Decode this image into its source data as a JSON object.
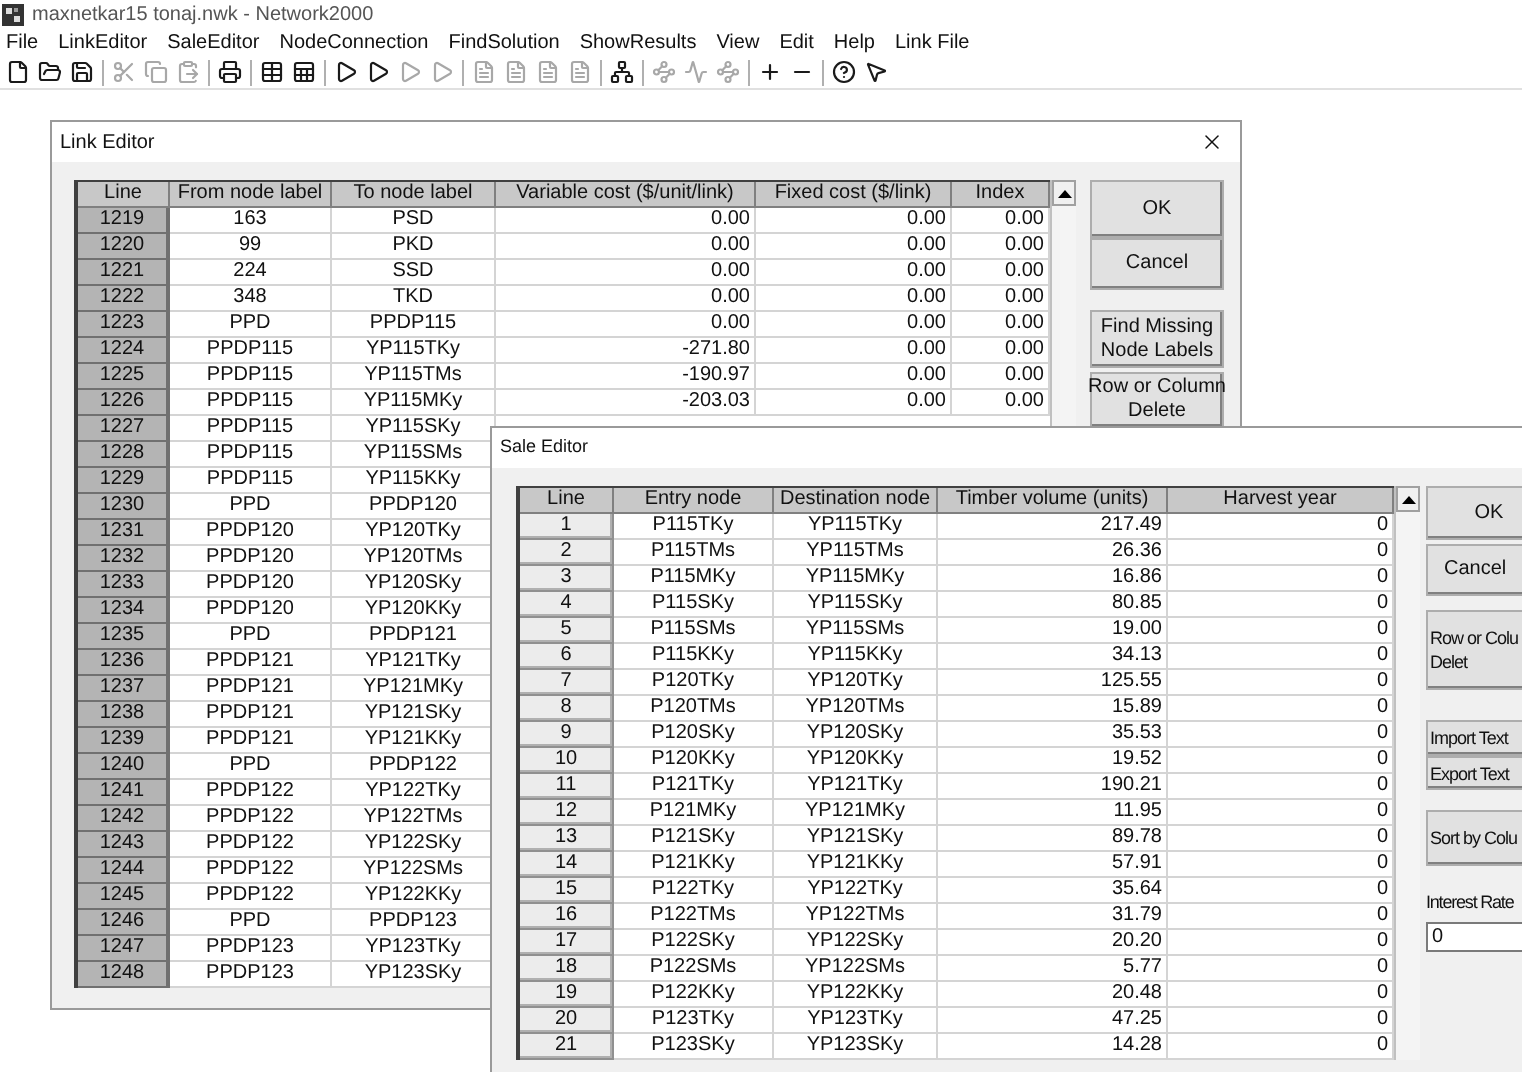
{
  "app": {
    "title": "maxnetkar15 tonaj.nwk - Network2000"
  },
  "menu": [
    "File",
    "LinkEditor",
    "SaleEditor",
    "NodeConnection",
    "FindSolution",
    "ShowResults",
    "View",
    "Edit",
    "Help",
    "Link File"
  ],
  "toolbar": [
    {
      "kind": "new",
      "disabled": false
    },
    {
      "kind": "open",
      "disabled": false
    },
    {
      "kind": "save",
      "disabled": false
    },
    {
      "kind": "separator"
    },
    {
      "kind": "cut",
      "disabled": true
    },
    {
      "kind": "copy",
      "disabled": true
    },
    {
      "kind": "paste",
      "disabled": true
    },
    {
      "kind": "separator"
    },
    {
      "kind": "print",
      "disabled": false
    },
    {
      "kind": "separator"
    },
    {
      "kind": "link_table",
      "disabled": false
    },
    {
      "kind": "sale_table",
      "disabled": false
    },
    {
      "kind": "separator"
    },
    {
      "kind": "go",
      "disabled": false
    },
    {
      "kind": "go",
      "disabled": false
    },
    {
      "kind": "go",
      "disabled": true
    },
    {
      "kind": "go",
      "disabled": true
    },
    {
      "kind": "separator"
    },
    {
      "kind": "report",
      "disabled": true
    },
    {
      "kind": "report",
      "disabled": true
    },
    {
      "kind": "report",
      "disabled": true
    },
    {
      "kind": "report",
      "disabled": true
    },
    {
      "kind": "separator"
    },
    {
      "kind": "node",
      "disabled": false
    },
    {
      "kind": "separator"
    },
    {
      "kind": "path",
      "disabled": true
    },
    {
      "kind": "wave",
      "disabled": true
    },
    {
      "kind": "path",
      "disabled": true
    },
    {
      "kind": "separator"
    },
    {
      "kind": "add_row",
      "disabled": false
    },
    {
      "kind": "remove_row",
      "disabled": false
    },
    {
      "kind": "separator"
    },
    {
      "kind": "help",
      "disabled": false
    },
    {
      "kind": "whats_this",
      "disabled": false
    }
  ],
  "link_editor": {
    "title": "Link Editor",
    "columns": [
      "Line",
      "From node label",
      "To node label",
      "Variable cost ($/unit/link)",
      "Fixed cost ($/link)",
      "Index"
    ],
    "rows": [
      [
        "1219",
        "163",
        "PSD",
        "0.00",
        "0.00",
        "0.00"
      ],
      [
        "1220",
        "99",
        "PKD",
        "0.00",
        "0.00",
        "0.00"
      ],
      [
        "1221",
        "224",
        "SSD",
        "0.00",
        "0.00",
        "0.00"
      ],
      [
        "1222",
        "348",
        "TKD",
        "0.00",
        "0.00",
        "0.00"
      ],
      [
        "1223",
        "PPD",
        "PPDP115",
        "0.00",
        "0.00",
        "0.00"
      ],
      [
        "1224",
        "PPDP115",
        "YP115TKy",
        "-271.80",
        "0.00",
        "0.00"
      ],
      [
        "1225",
        "PPDP115",
        "YP115TMs",
        "-190.97",
        "0.00",
        "0.00"
      ],
      [
        "1226",
        "PPDP115",
        "YP115MKy",
        "-203.03",
        "0.00",
        "0.00"
      ],
      [
        "1227",
        "PPDP115",
        "YP115SKy"
      ],
      [
        "1228",
        "PPDP115",
        "YP115SMs"
      ],
      [
        "1229",
        "PPDP115",
        "YP115KKy"
      ],
      [
        "1230",
        "PPD",
        "PPDP120"
      ],
      [
        "1231",
        "PPDP120",
        "YP120TKy"
      ],
      [
        "1232",
        "PPDP120",
        "YP120TMs"
      ],
      [
        "1233",
        "PPDP120",
        "YP120SKy"
      ],
      [
        "1234",
        "PPDP120",
        "YP120KKy"
      ],
      [
        "1235",
        "PPD",
        "PPDP121"
      ],
      [
        "1236",
        "PPDP121",
        "YP121TKy"
      ],
      [
        "1237",
        "PPDP121",
        "YP121MKy"
      ],
      [
        "1238",
        "PPDP121",
        "YP121SKy"
      ],
      [
        "1239",
        "PPDP121",
        "YP121KKy"
      ],
      [
        "1240",
        "PPD",
        "PPDP122"
      ],
      [
        "1241",
        "PPDP122",
        "YP122TKy"
      ],
      [
        "1242",
        "PPDP122",
        "YP122TMs"
      ],
      [
        "1243",
        "PPDP122",
        "YP122SKy"
      ],
      [
        "1244",
        "PPDP122",
        "YP122SMs"
      ],
      [
        "1245",
        "PPDP122",
        "YP122KKy"
      ],
      [
        "1246",
        "PPD",
        "PPDP123"
      ],
      [
        "1247",
        "PPDP123",
        "YP123TKy"
      ],
      [
        "1248",
        "PPDP123",
        "YP123SKy"
      ]
    ],
    "buttons": [
      {
        "lines": [
          "OK"
        ]
      },
      {
        "lines": [
          "Cancel"
        ]
      },
      {
        "lines": [
          "Find Missing",
          "Node Labels"
        ]
      },
      {
        "lines": [
          "Row or Column",
          "Delete"
        ]
      }
    ]
  },
  "sale_editor": {
    "title": "Sale Editor",
    "columns": [
      "Line",
      "Entry node",
      "Destination node",
      "Timber volume (units)",
      "Harvest year"
    ],
    "rows": [
      [
        "1",
        "P115TKy",
        "YP115TKy",
        "217.49",
        "0"
      ],
      [
        "2",
        "P115TMs",
        "YP115TMs",
        "26.36",
        "0"
      ],
      [
        "3",
        "P115MKy",
        "YP115MKy",
        "16.86",
        "0"
      ],
      [
        "4",
        "P115SKy",
        "YP115SKy",
        "80.85",
        "0"
      ],
      [
        "5",
        "P115SMs",
        "YP115SMs",
        "19.00",
        "0"
      ],
      [
        "6",
        "P115KKy",
        "YP115KKy",
        "34.13",
        "0"
      ],
      [
        "7",
        "P120TKy",
        "YP120TKy",
        "125.55",
        "0"
      ],
      [
        "8",
        "P120TMs",
        "YP120TMs",
        "15.89",
        "0"
      ],
      [
        "9",
        "P120SKy",
        "YP120SKy",
        "35.53",
        "0"
      ],
      [
        "10",
        "P120KKy",
        "YP120KKy",
        "19.52",
        "0"
      ],
      [
        "11",
        "P121TKy",
        "YP121TKy",
        "190.21",
        "0"
      ],
      [
        "12",
        "P121MKy",
        "YP121MKy",
        "11.95",
        "0"
      ],
      [
        "13",
        "P121SKy",
        "YP121SKy",
        "89.78",
        "0"
      ],
      [
        "14",
        "P121KKy",
        "YP121KKy",
        "57.91",
        "0"
      ],
      [
        "15",
        "P122TKy",
        "YP122TKy",
        "35.64",
        "0"
      ],
      [
        "16",
        "P122TMs",
        "YP122TMs",
        "31.79",
        "0"
      ],
      [
        "17",
        "P122SKy",
        "YP122SKy",
        "20.20",
        "0"
      ],
      [
        "18",
        "P122SMs",
        "YP122SMs",
        "5.77",
        "0"
      ],
      [
        "19",
        "P122KKy",
        "YP122KKy",
        "20.48",
        "0"
      ],
      [
        "20",
        "P123TKy",
        "YP123TKy",
        "47.25",
        "0"
      ],
      [
        "21",
        "P123SKy",
        "YP123SKy",
        "14.28",
        "0"
      ]
    ],
    "buttons": [
      {
        "lines": [
          "OK"
        ]
      },
      {
        "lines": [
          "Cancel"
        ]
      },
      {
        "lines": [
          "Row or Colu",
          "Delet"
        ]
      },
      {
        "lines": [
          "Import Text"
        ]
      },
      {
        "lines": [
          "Export Text"
        ]
      },
      {
        "lines": [
          "Sort by Colu"
        ]
      }
    ],
    "interest_rate": {
      "label": "Interest Rate",
      "value": "0"
    }
  }
}
